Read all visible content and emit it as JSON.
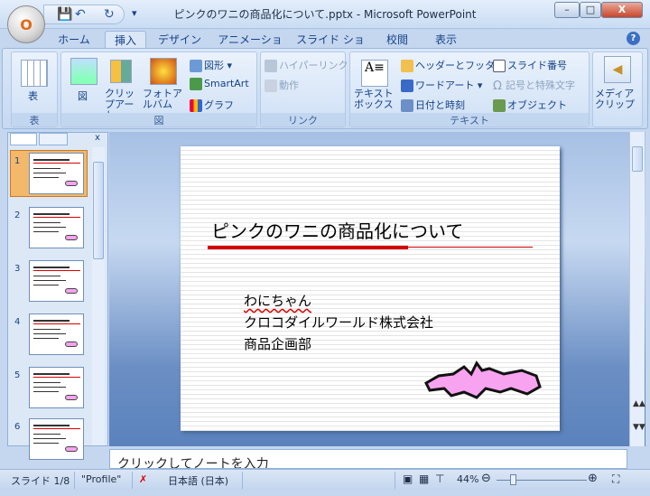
{
  "window": {
    "title": "ピンクのワニの商品化について.pptx - Microsoft PowerPoint",
    "minimize": "–",
    "maximize": "□",
    "close": "X"
  },
  "office_button": "O",
  "qat": {
    "save": "💾",
    "undo": "↶",
    "redo": "↻",
    "customize": "▾"
  },
  "tabs": [
    "ホーム",
    "挿入",
    "デザイン",
    "アニメーション",
    "スライド ショー",
    "校閲",
    "表示"
  ],
  "help": "?",
  "ribbon": {
    "table_group": {
      "table": "表",
      "label": "表"
    },
    "illustrations": {
      "picture": "図",
      "clipart": "クリップアート",
      "photo_album": "フォトアルバム",
      "shapes": "図形",
      "smartart": "SmartArt",
      "chart": "グラフ",
      "label": "図"
    },
    "links": {
      "hyperlink": "ハイパーリンク",
      "action": "動作",
      "label": "リンク"
    },
    "text": {
      "textbox": "テキストボックス",
      "header_footer": "ヘッダーとフッター",
      "wordart": "ワードアート",
      "datetime": "日付と時刻",
      "slide_number": "スライド番号",
      "symbol": "記号と特殊文字",
      "object": "オブジェクト",
      "label": "テキスト"
    },
    "media": {
      "media_clip": "メディアクリップ"
    }
  },
  "slides_panel": {
    "close": "x",
    "slides": [
      "1",
      "2",
      "3",
      "4",
      "5",
      "6"
    ],
    "selected": 1
  },
  "slide": {
    "title": "ピンクのワニの商品化について",
    "lines": [
      "わにちゃん",
      "クロコダイルワールド株式会社",
      "商品企画部"
    ]
  },
  "notes": {
    "placeholder": "クリックしてノートを入力"
  },
  "status": {
    "slide": "スライド 1/8",
    "theme": "\"Profile\"",
    "language": "日本語 (日本)",
    "zoom": "44%"
  },
  "colors": {
    "accent_red": "#d40000",
    "pink": "#f7a3f0"
  }
}
